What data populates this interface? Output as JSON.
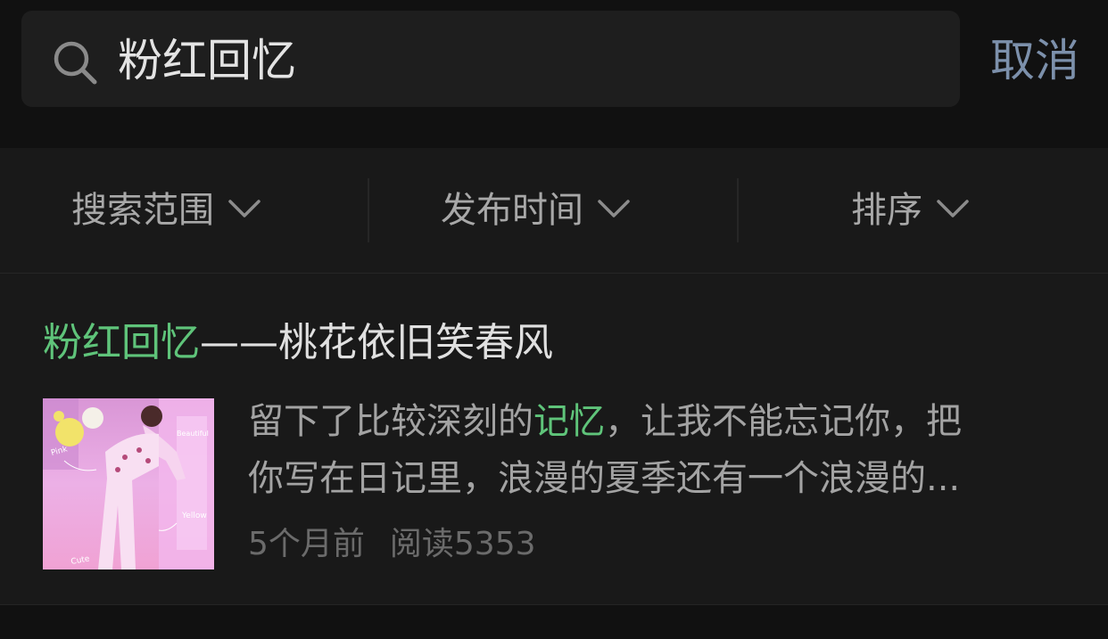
{
  "search": {
    "query": "粉红回忆",
    "cancel_label": "取消"
  },
  "filters": [
    {
      "label": "搜索范围"
    },
    {
      "label": "发布时间"
    },
    {
      "label": "排序"
    }
  ],
  "result": {
    "title_highlight": "粉红回忆",
    "title_rest": "——桃花依旧笑春风",
    "snippet_line1_before": "留下了比较深刻的",
    "snippet_highlight": "记忆",
    "snippet_line1_after": "，让我不能忘记你，把",
    "snippet_line2": "你写在日记里，浪漫的夏季还有一个浪漫的...",
    "time": "5个月前",
    "reads": "阅读5353",
    "thumbnail_labels": [
      "Pink",
      "Beautiful",
      "Yellow",
      "Cute"
    ]
  },
  "colors": {
    "background": "#111111",
    "panel": "#191919",
    "highlight": "#5fc47a",
    "cancel": "#7c90ab"
  }
}
